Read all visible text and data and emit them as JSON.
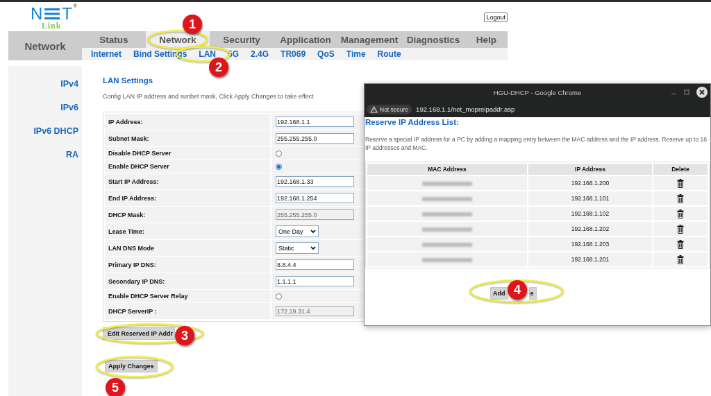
{
  "logo": {
    "left": "N",
    "right": "T",
    "tagline": "Link",
    "mark": "®"
  },
  "logout": "Logout",
  "section_title": "Network",
  "tabs": [
    {
      "label": "Status",
      "selected": false
    },
    {
      "label": "Network",
      "selected": true
    },
    {
      "label": "Security",
      "selected": false
    },
    {
      "label": "Application",
      "selected": false
    },
    {
      "label": "Management",
      "selected": false
    },
    {
      "label": "Diagnostics",
      "selected": false
    },
    {
      "label": "Help",
      "selected": false
    }
  ],
  "subtabs": [
    "Internet",
    "Bind Settings",
    "LAN",
    "5G",
    "2.4G",
    "TR069",
    "QoS",
    "Time",
    "Route"
  ],
  "sidebar": {
    "items": [
      "IPv4",
      "IPv6",
      "IPv6 DHCP",
      "RA"
    ]
  },
  "page_title": "LAN Settings",
  "description": "Config LAN IP address and sunbet mask, Click Apply Changes to take effect",
  "form": [
    {
      "kind": "text",
      "label": "IP Address:",
      "value": "192.168.1.1",
      "disabled": false
    },
    {
      "kind": "text",
      "label": "Subnet Mask:",
      "value": "255.255.255.0",
      "disabled": false
    },
    {
      "kind": "radio",
      "label": "Disable DHCP Server",
      "checked": false
    },
    {
      "kind": "radio",
      "label": "Enable DHCP Server",
      "checked": true
    },
    {
      "kind": "text",
      "label": "Start IP Address:",
      "value": "192.168.1.33",
      "disabled": false
    },
    {
      "kind": "text",
      "label": "End IP Address:",
      "value": "192.168.1.254",
      "disabled": false
    },
    {
      "kind": "text",
      "label": "DHCP Mask:",
      "value": "255.255.255.0",
      "disabled": true
    },
    {
      "kind": "select",
      "label": "Lease Time:",
      "value": "One Day"
    },
    {
      "kind": "select",
      "label": "LAN DNS Mode",
      "value": "Static"
    },
    {
      "kind": "text",
      "label": "Primary IP DNS:",
      "value": "8.8.4.4",
      "disabled": false
    },
    {
      "kind": "text",
      "label": "Secondary IP DNS:",
      "value": "1.1.1.1",
      "disabled": false
    },
    {
      "kind": "radio",
      "label": "Enable DHCP Server Relay",
      "checked": false
    },
    {
      "kind": "text",
      "label": "DHCP ServerIP :",
      "value": "172.19.31.4",
      "disabled": true
    }
  ],
  "edit_button": "Edit Reserved IP  Addr",
  "apply_button": "Apply Changes",
  "popup": {
    "title": "HGU-DHCP - Google Chrome",
    "security": "Not secure",
    "url": "192.168.1.1/net_mopreipaddr.asp",
    "heading": "Reserve IP Address List:",
    "description": "Reserve a special IP address for a PC by adding a mapping entry between the MAC address and the IP address. Reserve up to 16 IP addresses and MAC.",
    "columns": [
      "MAC Address",
      "IP Address",
      "Delete"
    ],
    "rows": [
      {
        "ip": "192.168.1.200"
      },
      {
        "ip": "192.168.1.101"
      },
      {
        "ip": "192.168.1.102"
      },
      {
        "ip": "192.168.1.202"
      },
      {
        "ip": "192.168.1.203"
      },
      {
        "ip": "192.168.1.201"
      }
    ],
    "buttons": [
      "Add",
      "e"
    ]
  },
  "markers": [
    "1",
    "2",
    "3",
    "4",
    "5"
  ]
}
